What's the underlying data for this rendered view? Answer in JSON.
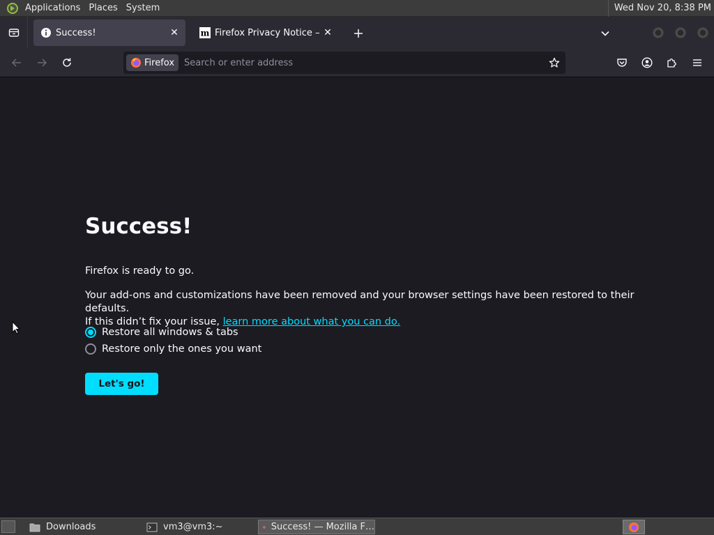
{
  "system_panel": {
    "menus": [
      "Applications",
      "Places",
      "System"
    ],
    "clock": "Wed Nov 20,  8:38 PM"
  },
  "tabs": [
    {
      "title": "Success!",
      "icon": "info-icon",
      "active": true
    },
    {
      "title": "Firefox Privacy Notice — Mozilla",
      "icon": "mozilla-m-icon",
      "active": false
    }
  ],
  "urlbar": {
    "identity_label": "Firefox",
    "placeholder": "Search or enter address"
  },
  "page": {
    "heading": "Success!",
    "ready_text": "Firefox is ready to go.",
    "explain_line1": "Your add-ons and customizations have been removed and your browser settings have been restored to their defaults.",
    "explain_line2_prefix": "If this didn’t fix your issue, ",
    "learn_link": "learn more about what you can do.",
    "option_restore_all": "Restore all windows & tabs",
    "option_restore_some": "Restore only the ones you want",
    "selected_option": "restore-all",
    "go_button": "Let's go!"
  },
  "taskbar": {
    "items": [
      "Downloads",
      "vm3@vm3:~",
      "Success! — Mozilla F…"
    ]
  },
  "colors": {
    "accent": "#00ddff",
    "page_bg": "#1c1b22",
    "toolbar_bg": "#2b2a33",
    "panel_bg": "#3c3c3c"
  }
}
